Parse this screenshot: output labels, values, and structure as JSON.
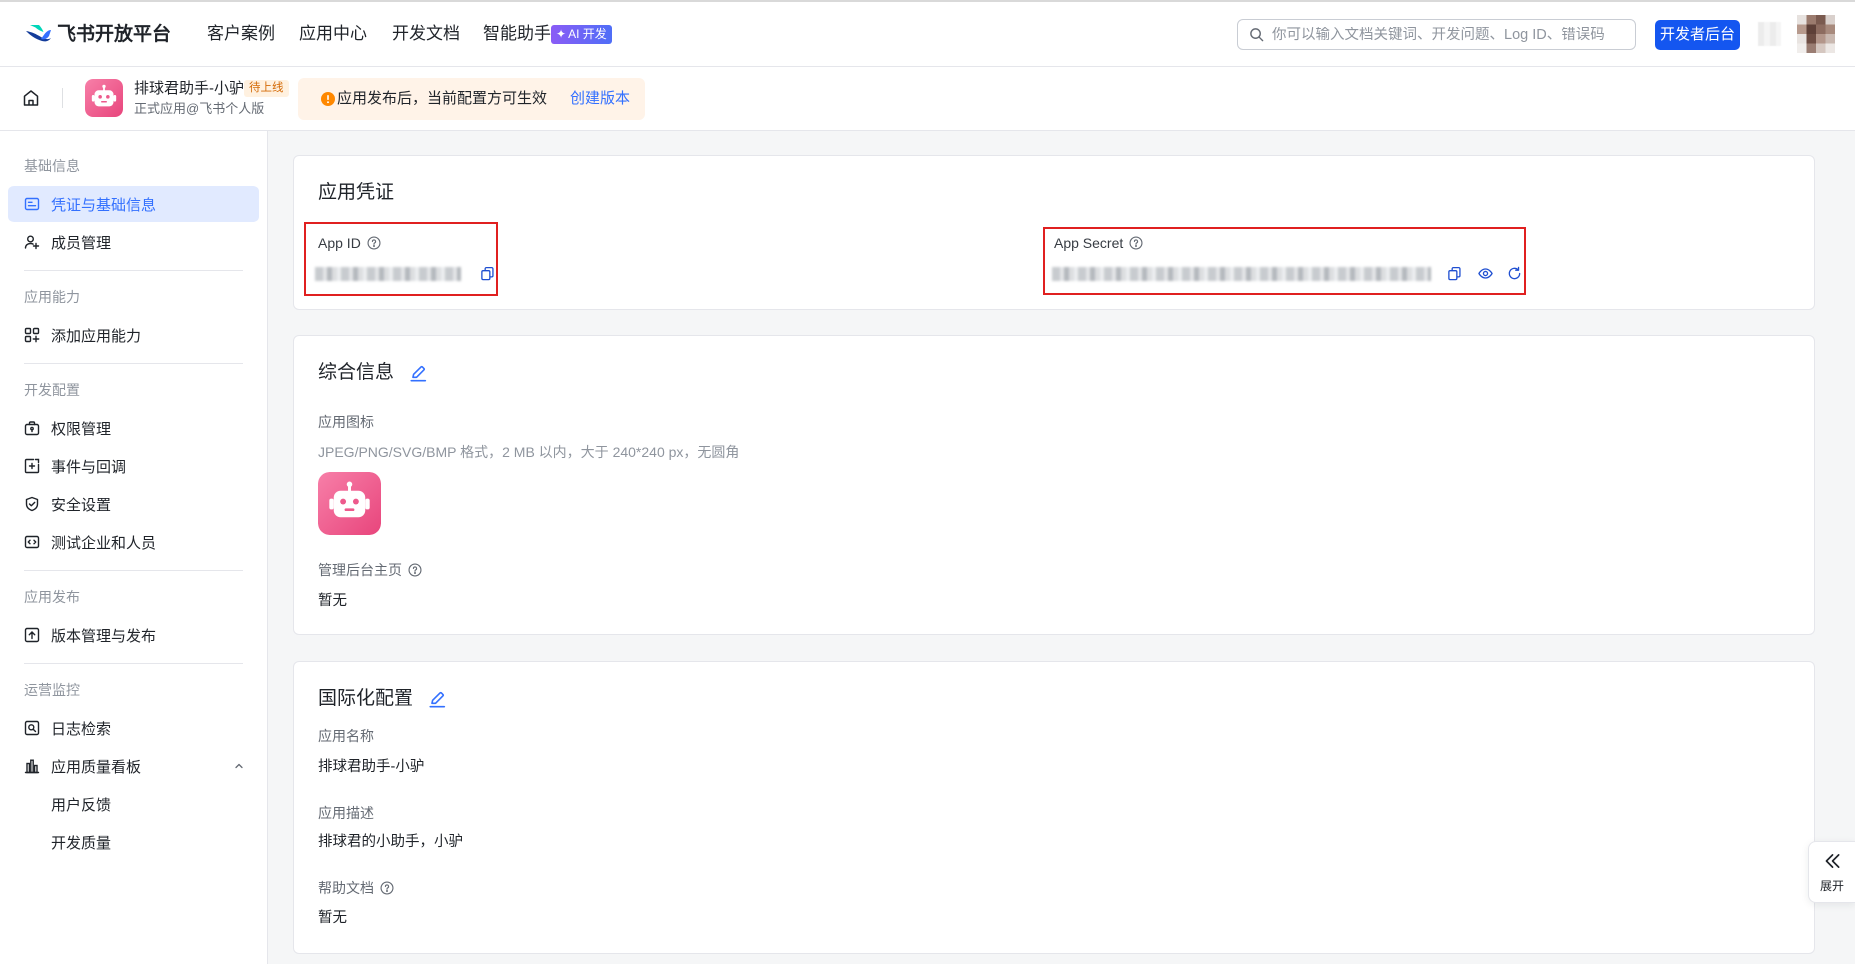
{
  "header": {
    "brand": "飞书开放平台",
    "nav": [
      {
        "label": "客户案例"
      },
      {
        "label": "应用中心"
      },
      {
        "label": "开发文档"
      },
      {
        "label": "智能助手"
      }
    ],
    "ai_badge": "AI 开发",
    "ai_badge_icon": "✦",
    "search": {
      "placeholder": "你可以输入文档关键词、开发问题、Log ID、错误码",
      "icon": "search-icon"
    },
    "console_button": "开发者后台"
  },
  "app_bar": {
    "app_name": "排球君助手-小驴",
    "status_badge": "待上线",
    "app_subtitle": "正式应用@飞书个人版",
    "notice": {
      "text": "应用发布后，当前配置方可生效",
      "link": "创建版本",
      "icon": "warning-icon"
    }
  },
  "sidebar": {
    "groups": [
      {
        "label": "基础信息",
        "items": [
          {
            "label": "凭证与基础信息",
            "icon": "credential-icon",
            "active": true
          },
          {
            "label": "成员管理",
            "icon": "member-add-icon"
          }
        ]
      },
      {
        "label": "应用能力",
        "items": [
          {
            "label": "添加应用能力",
            "icon": "add-capability-icon"
          }
        ]
      },
      {
        "label": "开发配置",
        "items": [
          {
            "label": "权限管理",
            "icon": "permission-icon"
          },
          {
            "label": "事件与回调",
            "icon": "event-callback-icon"
          },
          {
            "label": "安全设置",
            "icon": "shield-check-icon"
          },
          {
            "label": "测试企业和人员",
            "icon": "code-icon"
          }
        ]
      },
      {
        "label": "应用发布",
        "items": [
          {
            "label": "版本管理与发布",
            "icon": "upload-icon"
          }
        ]
      },
      {
        "label": "运营监控",
        "items": [
          {
            "label": "日志检索",
            "icon": "log-search-icon"
          },
          {
            "label": "应用质量看板",
            "icon": "bar-chart-icon",
            "expanded": true,
            "children": [
              {
                "label": "用户反馈"
              },
              {
                "label": "开发质量"
              }
            ]
          }
        ]
      }
    ]
  },
  "credentials": {
    "title": "应用凭证",
    "app_id_label": "App ID",
    "app_secret_label": "App Secret"
  },
  "general": {
    "title": "综合信息",
    "icon_label": "应用图标",
    "icon_hint": "JPEG/PNG/SVG/BMP 格式，2 MB 以内，大于 240*240 px，无圆角",
    "homepage_label": "管理后台主页",
    "homepage_value": "暂无"
  },
  "i18n": {
    "title": "国际化配置",
    "name_label": "应用名称",
    "name_value": "排球君助手-小驴",
    "desc_label": "应用描述",
    "desc_value": "排球君的小助手，小驴",
    "help_doc_label": "帮助文档",
    "help_doc_value": "暂无"
  },
  "float_panel": {
    "label": "展开",
    "icon": "double-chevron-left-icon"
  },
  "colors": {
    "accent": "#3370ff",
    "primary": "#1456f0",
    "active-bg": "#e1eaff",
    "highlight": "#e02020",
    "badge": "#d46b08",
    "badge-bg": "#fff1e0",
    "notice-bg": "#fff3e8",
    "warn": "#ff8800",
    "action": "#1f4fd1"
  }
}
